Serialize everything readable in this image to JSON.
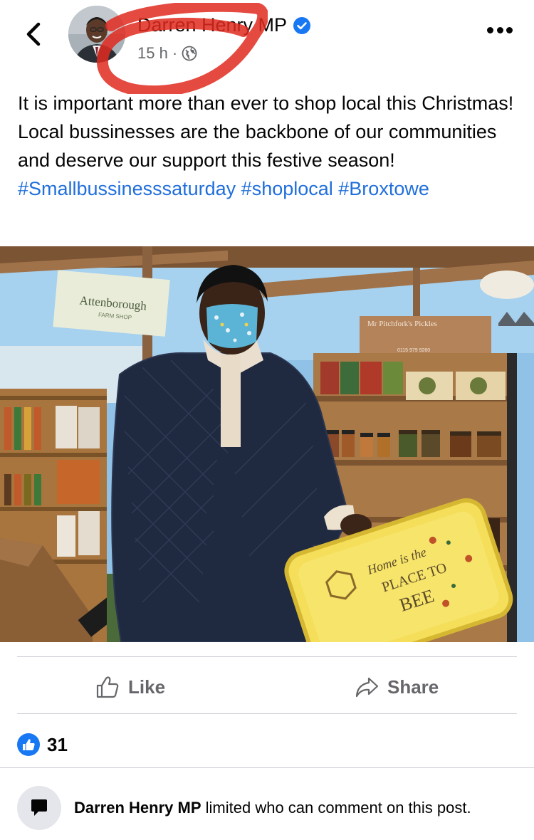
{
  "header": {
    "author": "Darren Henry MP",
    "time": "15 h",
    "separator": "·",
    "annotation_color": "#e02a1f"
  },
  "post": {
    "text": "It is important more than ever to shop local this Christmas! Local bussinesses are the backbone of our communities and deserve our support this festive season!",
    "hashtags": [
      "#Smallbussinesssaturday",
      "#shoplocal",
      "#Broxtowe"
    ]
  },
  "photo": {
    "shop_sign": "Attenborough",
    "shop_sign_sub": "FARM SHOP",
    "shelf_sign": "Mr Pitchfork's Pickles",
    "shelf_sign_phone": "0115 979 9260",
    "tray_text_1": "Home is the",
    "tray_text_2": "PLACE TO",
    "tray_text_3": "BEE"
  },
  "actions": {
    "like_label": "Like",
    "share_label": "Share"
  },
  "reactions": {
    "count": "31"
  },
  "notice": {
    "name": "Darren Henry MP",
    "message": "limited who can comment on this post."
  },
  "colors": {
    "link": "#216fdb",
    "secondary_text": "#65676b",
    "verified": "#1877f2"
  }
}
